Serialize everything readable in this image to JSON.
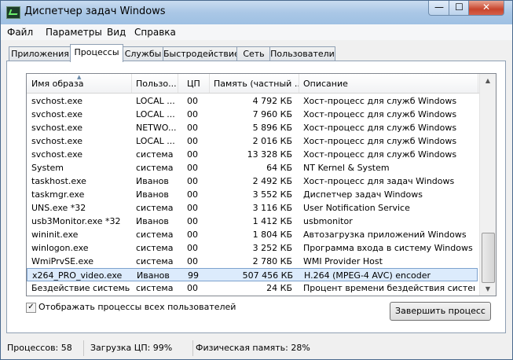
{
  "window": {
    "title": "Диспетчер задач Windows",
    "min_glyph": "—",
    "max_glyph": "☐",
    "close_glyph": "✕"
  },
  "menu": [
    "Файл",
    "Параметры",
    "Вид",
    "Справка"
  ],
  "tabs": [
    "Приложения",
    "Процессы",
    "Службы",
    "Быстродействие",
    "Сеть",
    "Пользователи"
  ],
  "active_tab": "Процессы",
  "columns": [
    "Имя образа",
    "Пользо...",
    "ЦП",
    "Память (частный ...",
    "Описание"
  ],
  "sort_glyph": "▲",
  "rows": [
    {
      "name": "svchost.exe",
      "user": "LOCAL ...",
      "cpu": "00",
      "mem": "4 792 КБ",
      "desc": "Хост-процесс для служб Windows"
    },
    {
      "name": "svchost.exe",
      "user": "LOCAL ...",
      "cpu": "00",
      "mem": "7 960 КБ",
      "desc": "Хост-процесс для служб Windows"
    },
    {
      "name": "svchost.exe",
      "user": "NETWO...",
      "cpu": "00",
      "mem": "5 896 КБ",
      "desc": "Хост-процесс для служб Windows"
    },
    {
      "name": "svchost.exe",
      "user": "LOCAL ...",
      "cpu": "00",
      "mem": "2 016 КБ",
      "desc": "Хост-процесс для служб Windows"
    },
    {
      "name": "svchost.exe",
      "user": "система",
      "cpu": "00",
      "mem": "13 328 КБ",
      "desc": "Хост-процесс для служб Windows"
    },
    {
      "name": "System",
      "user": "система",
      "cpu": "00",
      "mem": "64 КБ",
      "desc": "NT Kernel & System"
    },
    {
      "name": "taskhost.exe",
      "user": "Иванов",
      "cpu": "00",
      "mem": "2 492 КБ",
      "desc": "Хост-процесс для задач Windows"
    },
    {
      "name": "taskmgr.exe",
      "user": "Иванов",
      "cpu": "00",
      "mem": "3 552 КБ",
      "desc": "Диспетчер задач Windows"
    },
    {
      "name": "UNS.exe *32",
      "user": "система",
      "cpu": "00",
      "mem": "3 116 КБ",
      "desc": "User Notification Service"
    },
    {
      "name": "usb3Monitor.exe *32",
      "user": "Иванов",
      "cpu": "00",
      "mem": "1 412 КБ",
      "desc": "usbmonitor"
    },
    {
      "name": "wininit.exe",
      "user": "система",
      "cpu": "00",
      "mem": "1 804 КБ",
      "desc": "Автозагрузка приложений Windows"
    },
    {
      "name": "winlogon.exe",
      "user": "система",
      "cpu": "00",
      "mem": "3 252 КБ",
      "desc": "Программа входа в систему Windows"
    },
    {
      "name": "WmiPrvSE.exe",
      "user": "система",
      "cpu": "00",
      "mem": "2 780 КБ",
      "desc": "WMI Provider Host"
    },
    {
      "name": "x264_PRO_video.exe",
      "user": "Иванов",
      "cpu": "99",
      "mem": "507 456 КБ",
      "desc": "H.264 (MPEG-4 AVC) encoder",
      "selected": true
    },
    {
      "name": "Бездействие системы",
      "user": "система",
      "cpu": "00",
      "mem": "24 КБ",
      "desc": "Процент времени бездействия системы"
    }
  ],
  "scroll": {
    "up_glyph": "▲",
    "down_glyph": "▼"
  },
  "show_all_label": "Отображать процессы всех пользователей",
  "show_all_checked": true,
  "check_glyph": "✓",
  "end_process_label": "Завершить процесс",
  "status": {
    "processes": "Процессов: 58",
    "cpu": "Загрузка ЦП: 99%",
    "memory": "Физическая память: 28%"
  }
}
